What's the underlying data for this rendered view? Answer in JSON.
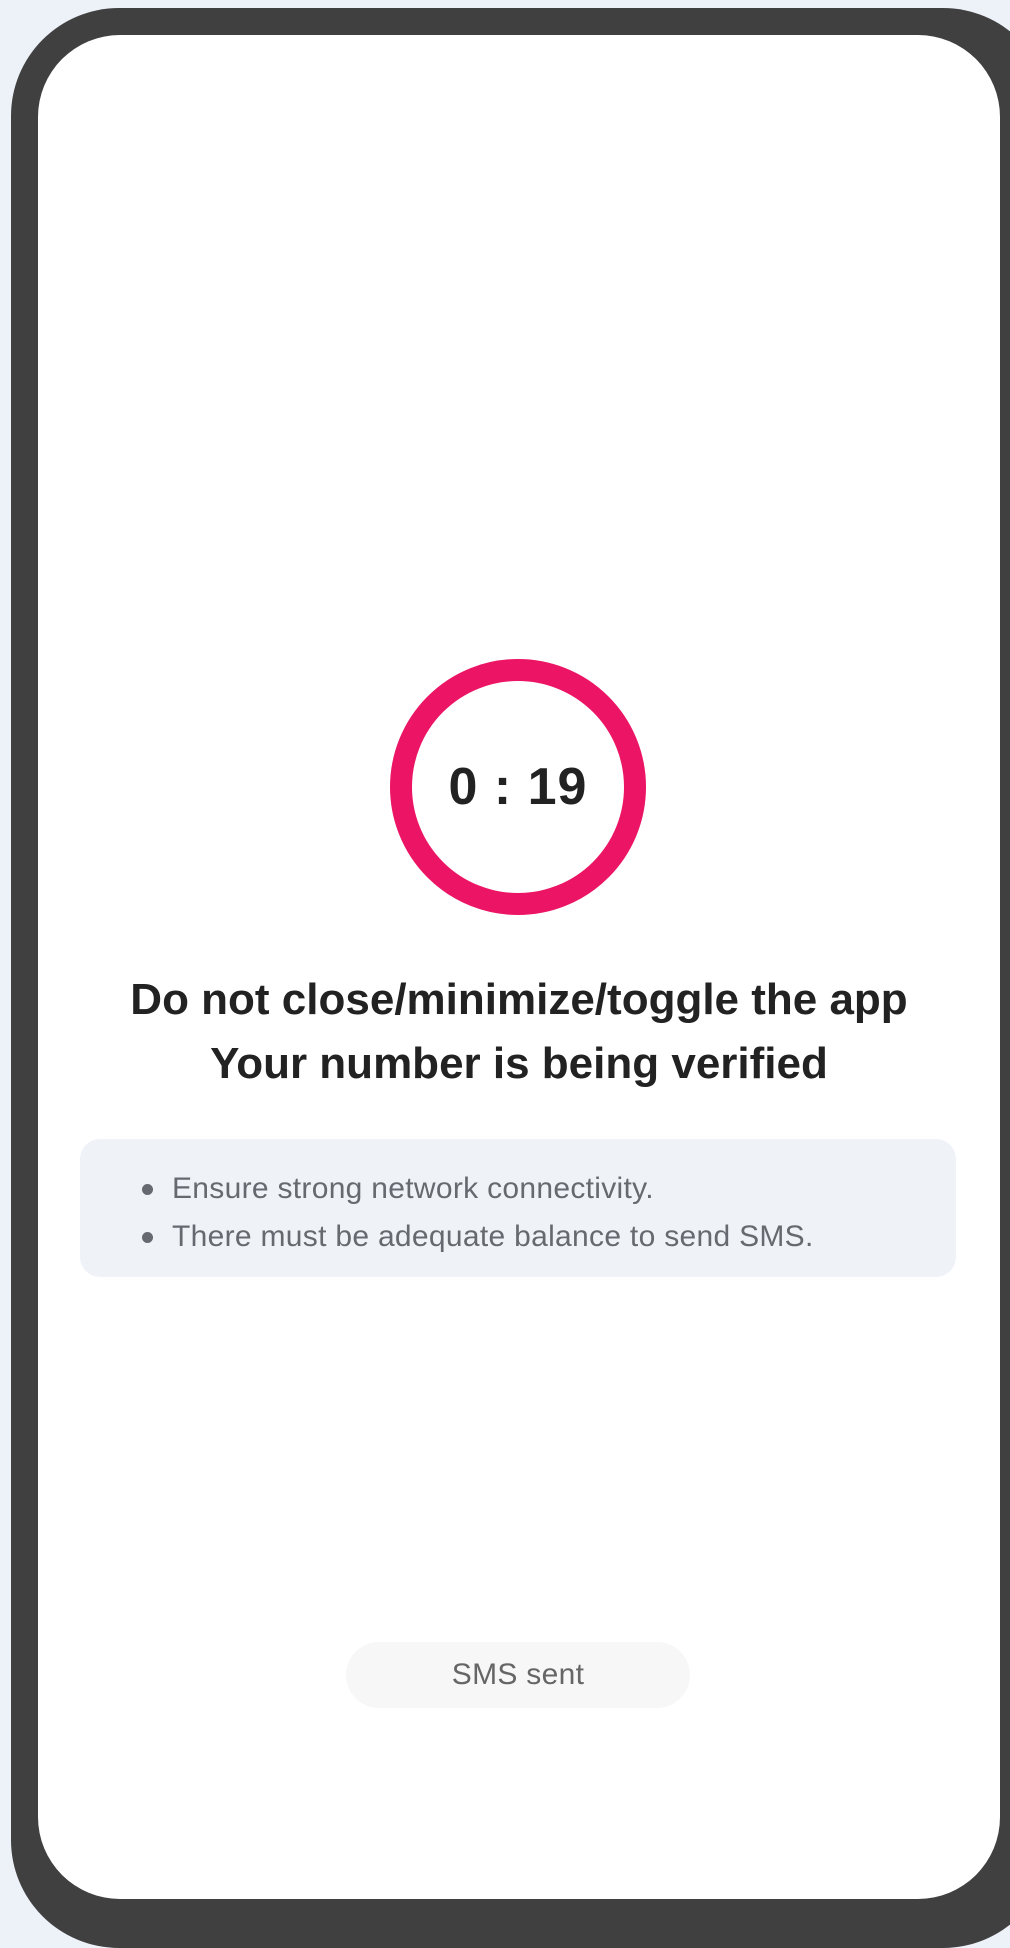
{
  "verification": {
    "timer": "0 : 19",
    "heading_line1": "Do not close/minimize/toggle the app",
    "heading_line2": "Your number is being verified",
    "notes": [
      "Ensure strong network connectivity.",
      "There must be adequate balance to send SMS."
    ],
    "status": "SMS sent"
  },
  "colors": {
    "accent": "#ec1464",
    "frame": "#404040",
    "background": "#edf1f8",
    "notes_background": "#eff3f7",
    "text_primary": "#222222",
    "text_secondary": "#666a70"
  }
}
